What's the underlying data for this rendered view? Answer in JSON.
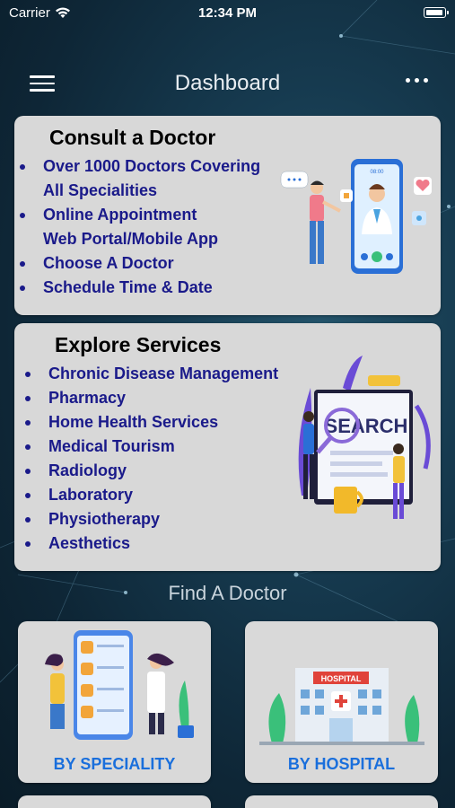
{
  "status_bar": {
    "carrier": "Carrier",
    "time": "12:34 PM"
  },
  "nav": {
    "title": "Dashboard",
    "menu_icon": "hamburger-icon",
    "more_icon": "more-icon"
  },
  "consult": {
    "title": "Consult a Doctor",
    "items": [
      "Over 1000 Doctors Covering",
      "All Specialities",
      "Online Appointment",
      "Web Portal/Mobile App",
      "Choose A Doctor",
      "Schedule Time & Date"
    ],
    "bubble_text": "08:00"
  },
  "explore": {
    "title": "Explore Services",
    "items": [
      "Chronic Disease Management",
      "Pharmacy",
      "Home Health Services",
      "Medical Tourism",
      "Radiology",
      "Laboratory",
      "Physiotherapy",
      "Aesthetics"
    ],
    "search_text": "SEARCH"
  },
  "find": {
    "heading": "Find A Doctor",
    "tiles": [
      {
        "label": "BY SPECIALITY"
      },
      {
        "label": "BY HOSPITAL",
        "sign": "HOSPITAL"
      }
    ]
  },
  "colors": {
    "bullet_text": "#1a1a8a",
    "tile_label": "#1a6fdc",
    "card_bg": "#d8d8d8"
  }
}
